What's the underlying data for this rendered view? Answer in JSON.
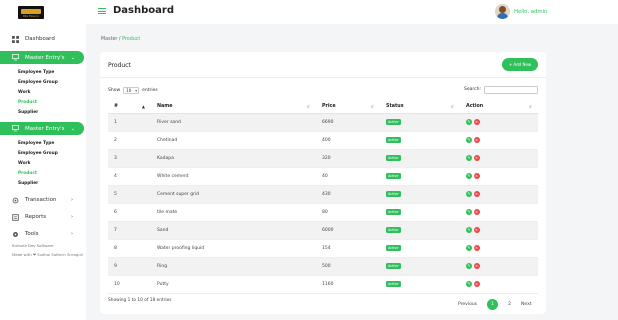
{
  "app": {
    "logo_text": "Bite Tobacco",
    "brand_color": "#2fbf5b"
  },
  "topbar": {
    "title": "Dashboard",
    "greeting": "Hello, admin"
  },
  "sidebar": {
    "dashboard": "Dashboard",
    "master1": "Master Entry's",
    "master1_sub": [
      "Employee Type",
      "Employee Group",
      "Work",
      "Product",
      "Supplier"
    ],
    "master2": "Master Entry's",
    "master2_sub": [
      "Employee Type",
      "Employee Group",
      "Work",
      "Product",
      "Supplier"
    ],
    "transaction": "Transaction",
    "reports": "Reports",
    "tools": "Tools",
    "footer1": "Bullseie Dev Software",
    "footer2": "Made with ❤ Sudhai Softech Sriraguli"
  },
  "breadcrumb": {
    "root": "Master",
    "sep": "/",
    "current": "Product"
  },
  "card": {
    "title": "Product",
    "add_label": "+ Add New",
    "show_label": "Show",
    "entries_value": "10",
    "entries_label": "entries",
    "search_label": "Search:",
    "search_value": "",
    "columns": [
      "#",
      "Name",
      "Price",
      "Status",
      "Action"
    ],
    "rows": [
      {
        "n": "1",
        "name": "River sand",
        "price": "6690",
        "status": "Active"
      },
      {
        "n": "2",
        "name": "Chetinad",
        "price": "400",
        "status": "Active"
      },
      {
        "n": "3",
        "name": "Kadapa",
        "price": "320",
        "status": "Active"
      },
      {
        "n": "4",
        "name": "White cement",
        "price": "40",
        "status": "Active"
      },
      {
        "n": "5",
        "name": "Cement super grid",
        "price": "430",
        "status": "Active"
      },
      {
        "n": "6",
        "name": "tile mate",
        "price": "80",
        "status": "Active"
      },
      {
        "n": "7",
        "name": "Sand",
        "price": "6000",
        "status": "Active"
      },
      {
        "n": "8",
        "name": "Water proofing liquid",
        "price": "154",
        "status": "Active"
      },
      {
        "n": "9",
        "name": "Ring",
        "price": "500",
        "status": "Active"
      },
      {
        "n": "10",
        "name": "Putty",
        "price": "1160",
        "status": "Active"
      }
    ],
    "info": "Showing 1 to 10 of 18 entries",
    "pager": {
      "previous": "Previous",
      "pages": [
        "1",
        "2"
      ],
      "current": "1",
      "next": "Next"
    }
  }
}
